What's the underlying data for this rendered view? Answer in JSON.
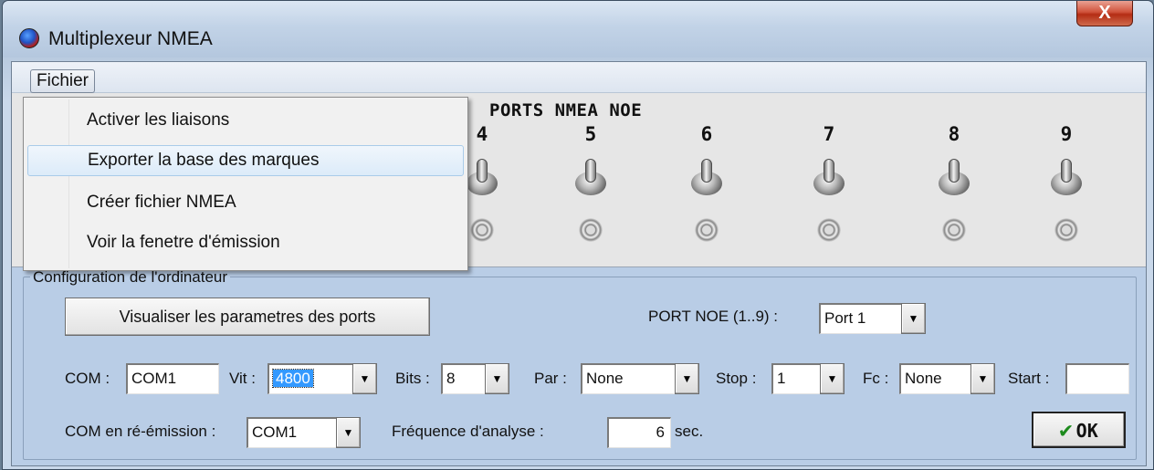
{
  "window": {
    "title": "Multiplexeur NMEA",
    "close_label": "X"
  },
  "menu": {
    "fichier": "Fichier",
    "items": [
      {
        "label": "Activer les liaisons"
      },
      {
        "label": "Exporter la base des marques"
      },
      {
        "label": "Créer fichier NMEA"
      },
      {
        "label": "Voir la fenetre d'émission"
      }
    ]
  },
  "ports": {
    "title": "PORTS NMEA NOE",
    "numbers": [
      "4",
      "5",
      "6",
      "7",
      "8",
      "9"
    ]
  },
  "config": {
    "legend": "Configuration de l'ordinateur",
    "view_params_button": "Visualiser les parametres des ports",
    "port_noe_label": "PORT NOE (1..9) :",
    "port_noe_value": "Port 1",
    "com_label": "COM :",
    "com_value": "COM1",
    "vit_label": "Vit :",
    "vit_value": "4800",
    "bits_label": "Bits :",
    "bits_value": "8",
    "par_label": "Par :",
    "par_value": "None",
    "stop_label": "Stop :",
    "stop_value": "1",
    "fc_label": "Fc :",
    "fc_value": "None",
    "start_label": "Start :",
    "start_value": "",
    "reemit_label": "COM en ré-émission :",
    "reemit_value": "COM1",
    "freq_label": "Fréquence  d'analyse :",
    "freq_value": "6",
    "freq_unit": "sec.",
    "ok_label": "OK"
  }
}
